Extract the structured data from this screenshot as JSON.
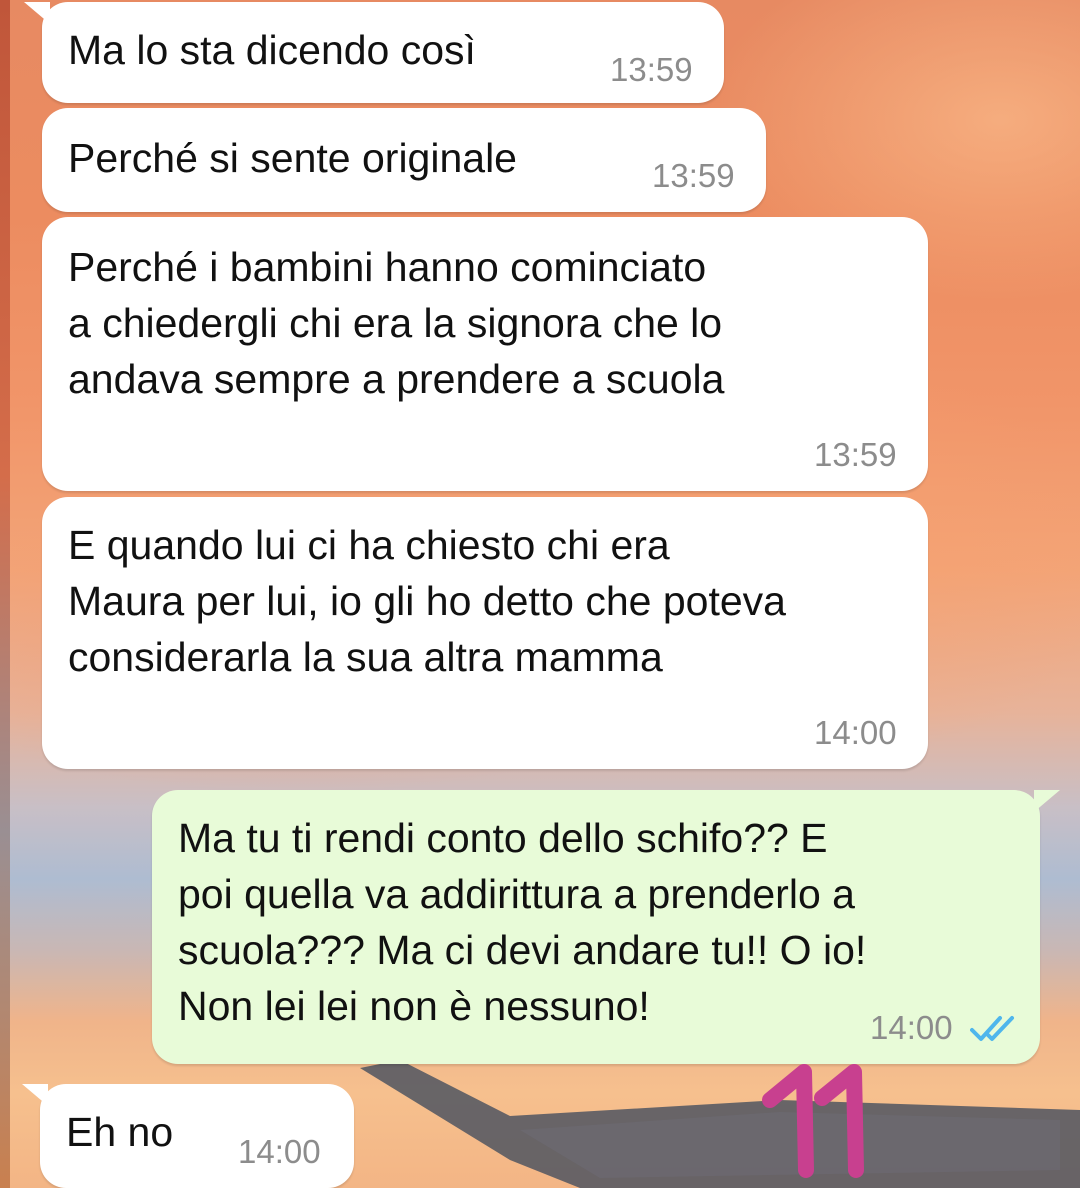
{
  "messages": [
    {
      "direction": "incoming",
      "text": "Ma lo sta dicendo così",
      "time": "13:59"
    },
    {
      "direction": "incoming",
      "text": "Perché si sente originale",
      "time": "13:59"
    },
    {
      "direction": "incoming",
      "text": "Perché i bambini hanno cominciato\na chiedergli chi era la signora che lo\nandava sempre a prendere a scuola",
      "time": "13:59"
    },
    {
      "direction": "incoming",
      "text": "E quando lui ci ha chiesto chi era\nMaura per lui, io gli ho detto che poteva\nconsiderarla la sua altra mamma",
      "time": "14:00"
    },
    {
      "direction": "outgoing",
      "text": "Ma tu ti rendi conto dello schifo?? E\npoi quella va addirittura a prenderlo a\nscuola??? Ma ci devi andare tu!! O io!\nNon lei lei non è nessuno!",
      "time": "14:00",
      "status": "read",
      "status_icon": "double-check-icon"
    },
    {
      "direction": "incoming",
      "text": "Eh no",
      "time": "14:00"
    }
  ],
  "page_number": "11",
  "colors": {
    "incoming_bubble": "#ffffff",
    "outgoing_bubble": "#e8fbd8",
    "read_ticks": "#4fb6ec",
    "timestamp": "#8c8c8c",
    "page_number": "#c8408f"
  }
}
